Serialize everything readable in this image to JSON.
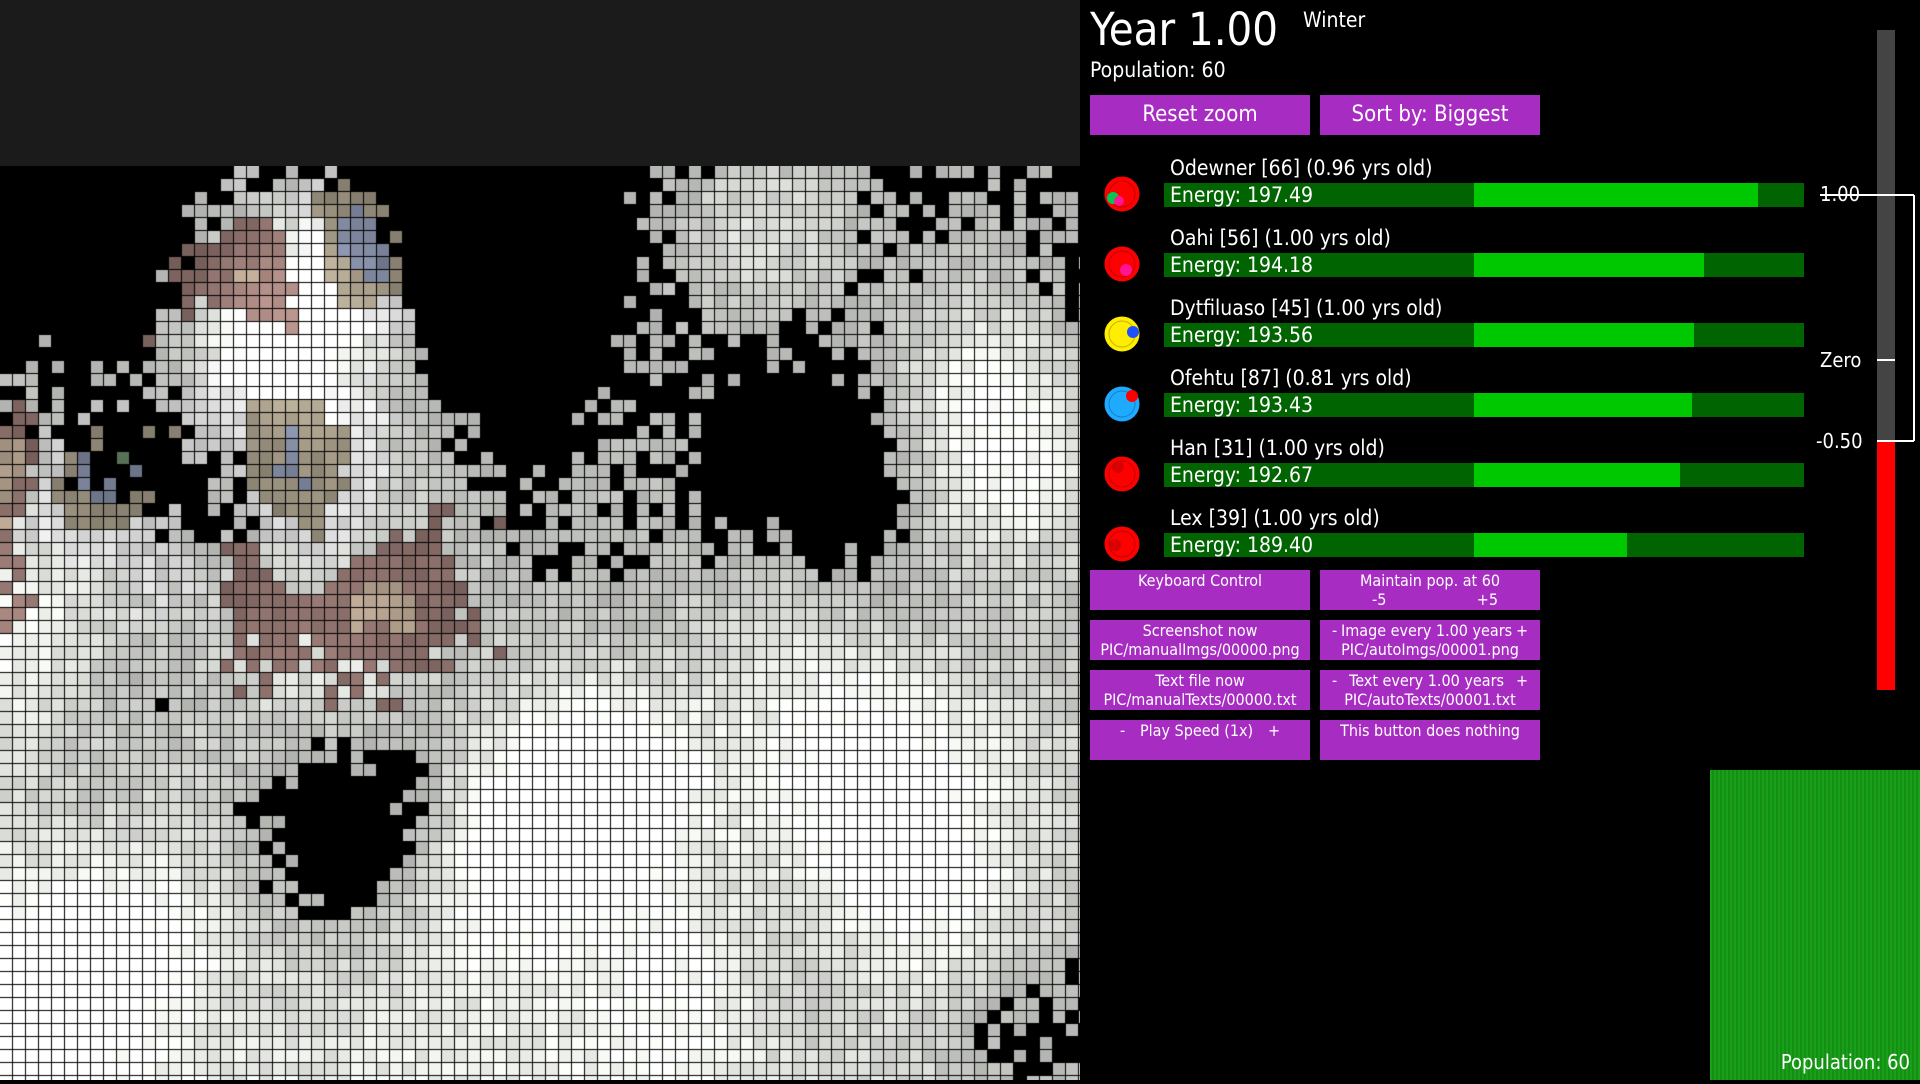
{
  "header": {
    "year": "Year 1.00",
    "season": "Winter",
    "population": "Population: 60"
  },
  "buttons": {
    "reset_zoom": "Reset zoom",
    "sort_by": "Sort by: Biggest",
    "keyboard_control": "Keyboard Control",
    "maintain_pop": "Maintain pop. at 60",
    "maintain_minus": "-5",
    "maintain_plus": "+5",
    "screenshot_now": "Screenshot now",
    "screenshot_path": "PIC/manualImgs/00000.png",
    "image_every_minus": "-",
    "image_every": "Image every 1.00 years",
    "image_every_plus": "+",
    "image_path": "PIC/autoImgs/00001.png",
    "text_file_now": "Text file now",
    "text_file_path": "PIC/manualTexts/00000.txt",
    "text_every_minus": "-",
    "text_every": "Text every 1.00 years",
    "text_every_plus": "+",
    "text_path": "PIC/autoTexts/00001.txt",
    "speed_minus": "-",
    "play_speed": "Play Speed (1x)",
    "speed_plus": "+",
    "nothing": "This button does nothing"
  },
  "creatures": [
    {
      "label": "Odewner [66] (0.96 yrs old)",
      "energy_text": "Energy: 197.49",
      "energy": 197.49,
      "body_color": "#ff0000",
      "eye_color": "#00c853",
      "eye2_color": "#ff1493"
    },
    {
      "label": "Oahi [56] (1.00 yrs old)",
      "energy_text": "Energy: 194.18",
      "energy": 194.18,
      "body_color": "#ff0000",
      "eye_color": "#ff1493",
      "eye2_color": ""
    },
    {
      "label": "Dytfiluaso [45] (1.00 yrs old)",
      "energy_text": "Energy: 193.56",
      "energy": 193.56,
      "body_color": "#ffee00",
      "eye_color": "#1e50ff",
      "eye2_color": ""
    },
    {
      "label": "Ofehtu [87] (0.81 yrs old)",
      "energy_text": "Energy: 193.43",
      "energy": 193.43,
      "body_color": "#1eaaff",
      "eye_color": "#ff0000",
      "eye2_color": ""
    },
    {
      "label": "Han [31] (1.00 yrs old)",
      "energy_text": "Energy: 192.67",
      "energy": 192.67,
      "body_color": "#ff0000",
      "eye_color": "#d80000",
      "eye2_color": ""
    },
    {
      "label": "Lex [39] (1.00 yrs old)",
      "energy_text": "Energy: 189.40",
      "energy": 189.4,
      "body_color": "#ff0000",
      "eye_color": "#d80000",
      "eye2_color": ""
    }
  ],
  "graph": {
    "top_label": "1.00",
    "zero_label": "Zero",
    "bottom_label": "-0.50",
    "value": -0.5,
    "negative_color": "#ff0000",
    "bar_bg_color": "#444444"
  },
  "population_graph": {
    "label": "Population: 60",
    "color": "#1aa31a"
  },
  "colors": {
    "button": "#a72cc2",
    "energy_fill": "#00c800",
    "energy_bg": "#006400"
  }
}
